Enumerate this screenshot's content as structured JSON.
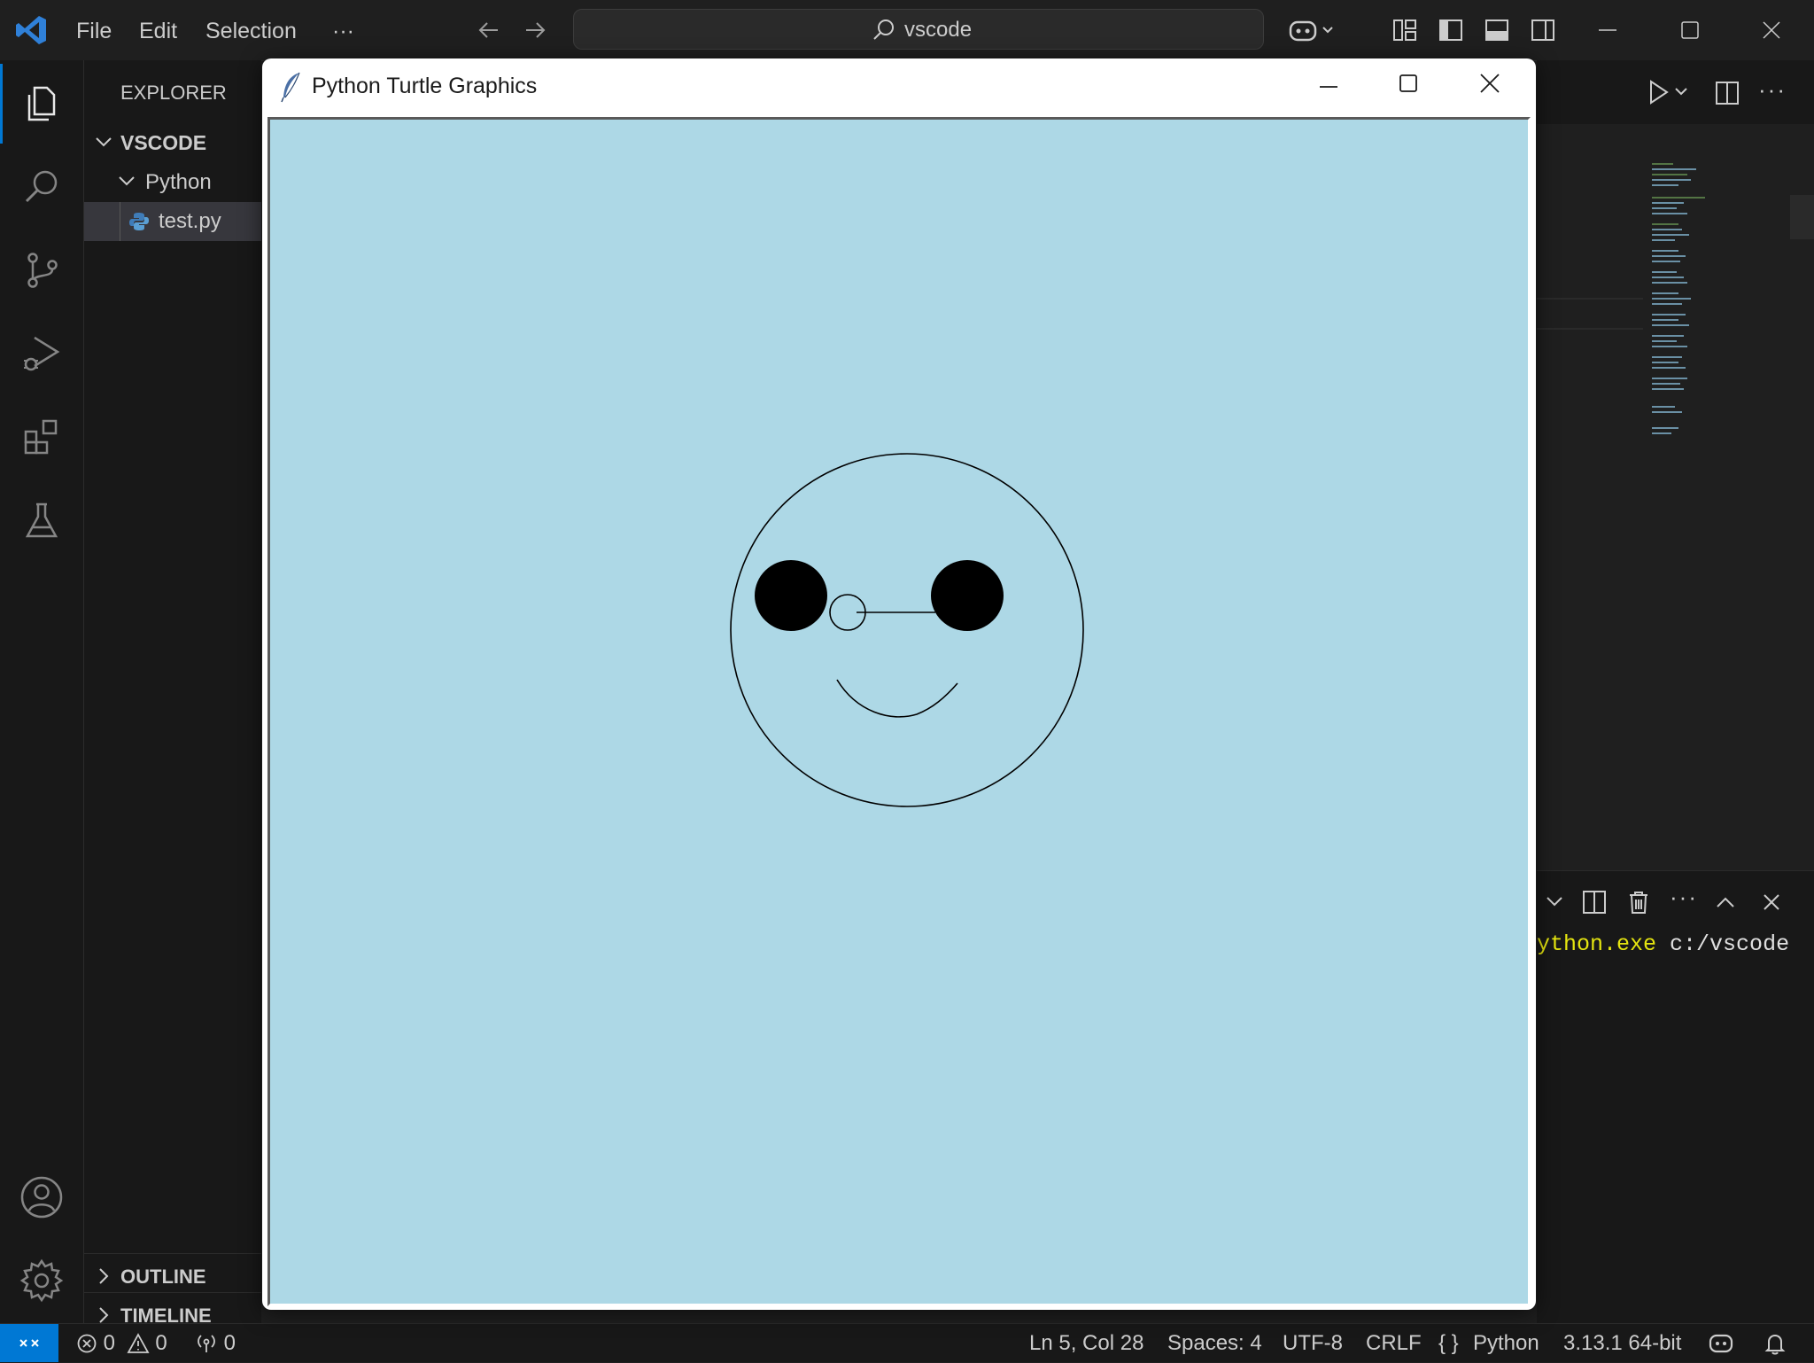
{
  "menubar": {
    "file": "File",
    "edit": "Edit",
    "selection": "Selection",
    "more": "···"
  },
  "command_center": {
    "text": "vscode"
  },
  "sidebar": {
    "header": "EXPLORER",
    "root": "VSCODE",
    "folder": "Python",
    "file": "test.py",
    "outline": "OUTLINE",
    "timeline": "TIMELINE"
  },
  "turtle_window": {
    "title": "Python Turtle Graphics",
    "canvas_color": "#add8e6"
  },
  "terminal": {
    "line_cmd": "ython.exe",
    "line_path": "c:/vscode"
  },
  "statusbar": {
    "errors": "0",
    "warnings": "0",
    "ports": "0",
    "position": "Ln 5, Col 28",
    "spaces": "Spaces: 4",
    "encoding": "UTF-8",
    "eol": "CRLF",
    "language_braces": "{ }",
    "language": "Python",
    "interpreter": "3.13.1 64-bit"
  },
  "colors": {
    "accent": "#0078d4",
    "brand": "#2f80d8",
    "terminal_yellow": "#e5e510"
  }
}
